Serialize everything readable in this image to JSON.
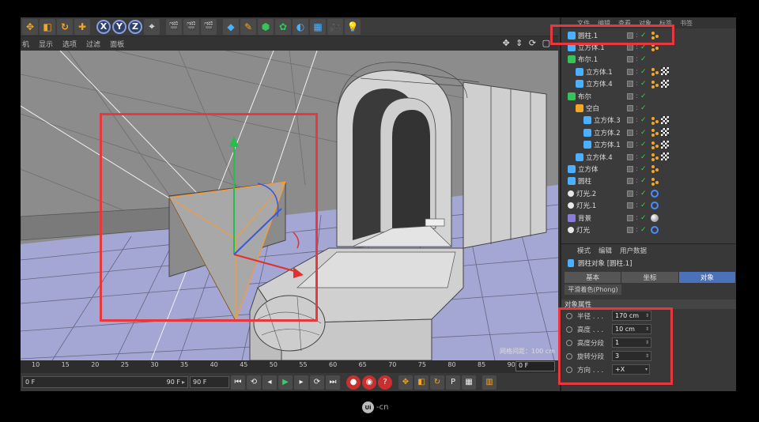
{
  "toolbar": {
    "axis_x": "X",
    "axis_y": "Y",
    "axis_z": "Z"
  },
  "viewport_menu": {
    "items": [
      "机",
      "显示",
      "选项",
      "过滤",
      "面板"
    ]
  },
  "viewport": {
    "grid_spacing_readout": "网格间距：100 cm"
  },
  "timeline": {
    "ticks": [
      "10",
      "15",
      "20",
      "25",
      "30",
      "35",
      "40",
      "45",
      "50",
      "55",
      "60",
      "65",
      "70",
      "75",
      "80",
      "85",
      "90"
    ],
    "frame_field": "0 F"
  },
  "playback": {
    "start_field": "0 F",
    "end_field_inner": "90 F",
    "end_field": "90 F",
    "arrow": "▸"
  },
  "object_manager": {
    "menu": [
      "文件",
      "编辑",
      "查看",
      "对象",
      "标签",
      "书签"
    ],
    "objects": [
      {
        "name": "圆柱.1",
        "indent": 0,
        "icon": "cylinder-icon",
        "tags": [
          "dots"
        ]
      },
      {
        "name": "立方体.1",
        "indent": 0,
        "icon": "cube-icon",
        "tags": [
          "dots"
        ]
      },
      {
        "name": "布尔.1",
        "indent": 0,
        "icon": "boolean-icon",
        "tags": []
      },
      {
        "name": "立方体.1",
        "indent": 1,
        "icon": "cube-icon",
        "tags": [
          "dots",
          "check"
        ]
      },
      {
        "name": "立方体.4",
        "indent": 1,
        "icon": "cube-icon",
        "tags": [
          "dots",
          "check"
        ]
      },
      {
        "name": "布尔",
        "indent": 0,
        "icon": "boolean-icon",
        "tags": []
      },
      {
        "name": "空白",
        "indent": 1,
        "icon": "null-icon",
        "tags": []
      },
      {
        "name": "立方体.3",
        "indent": 2,
        "icon": "cube-icon",
        "tags": [
          "dots",
          "check"
        ]
      },
      {
        "name": "立方体.2",
        "indent": 2,
        "icon": "cube-icon",
        "tags": [
          "dots",
          "check"
        ]
      },
      {
        "name": "立方体.1",
        "indent": 2,
        "icon": "cube-icon",
        "tags": [
          "dots",
          "check"
        ]
      },
      {
        "name": "立方体.4",
        "indent": 1,
        "icon": "cube-icon",
        "tags": [
          "dots",
          "check"
        ]
      },
      {
        "name": "立方体",
        "indent": 0,
        "icon": "cube-icon",
        "tags": [
          "dots"
        ]
      },
      {
        "name": "圆柱",
        "indent": 0,
        "icon": "cylinder-icon",
        "tags": [
          "dots"
        ]
      },
      {
        "name": "灯光.2",
        "indent": 0,
        "icon": "light-icon",
        "tags": [
          "ring"
        ]
      },
      {
        "name": "灯光.1",
        "indent": 0,
        "icon": "light-icon",
        "tags": [
          "ring"
        ]
      },
      {
        "name": "背景",
        "indent": 0,
        "icon": "background-icon",
        "tags": [
          "ball"
        ]
      },
      {
        "name": "灯光",
        "indent": 0,
        "icon": "light-icon",
        "tags": [
          "ring"
        ]
      }
    ]
  },
  "attributes": {
    "menu": [
      "模式",
      "编辑",
      "用户数据"
    ],
    "title": "圆柱对象 [圆柱.1]",
    "tabs": [
      "基本",
      "坐标",
      "对象"
    ],
    "active_tab": "对象",
    "phong_tab": "平滑着色(Phong)",
    "section_title": "对象属性",
    "props": [
      {
        "label": "半径 . . .",
        "value": "170 cm"
      },
      {
        "label": "高度 . . .",
        "value": "10 cm"
      },
      {
        "label": "高度分段",
        "value": "1"
      },
      {
        "label": "旋转分段",
        "value": "3"
      },
      {
        "label": "方向 . . .",
        "value": "+X"
      }
    ]
  },
  "watermark": {
    "logo": "Ui",
    "text": "-cn"
  },
  "colors": {
    "highlight": "#e8383d",
    "active_tab": "#4b72b8",
    "check": "#3ad04a",
    "accent_orange": "#f5a623"
  }
}
